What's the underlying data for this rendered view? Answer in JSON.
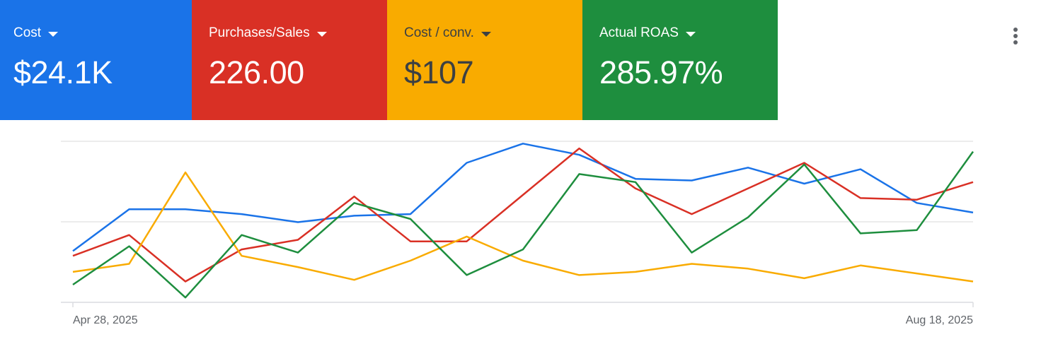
{
  "metrics": [
    {
      "label": "Cost",
      "value": "$24.1K",
      "bg": "#1a73e8",
      "fg": "#ffffff"
    },
    {
      "label": "Purchases/Sales",
      "value": "226.00",
      "bg": "#d93025",
      "fg": "#ffffff"
    },
    {
      "label": "Cost / conv.",
      "value": "$107",
      "bg": "#f9ab00",
      "fg": "#3c4043"
    },
    {
      "label": "Actual ROAS",
      "value": "285.97%",
      "bg": "#1e8e3e",
      "fg": "#ffffff"
    }
  ],
  "more_menu_icon": "more-vert-icon",
  "chart_data": {
    "type": "line",
    "x_start_label": "Apr 28, 2025",
    "x_end_label": "Aug 18, 2025",
    "x": [
      "Apr 28, 2025",
      "May 5, 2025",
      "May 12, 2025",
      "May 19, 2025",
      "May 26, 2025",
      "Jun 2, 2025",
      "Jun 9, 2025",
      "Jun 16, 2025",
      "Jun 23, 2025",
      "Jun 30, 2025",
      "Jul 7, 2025",
      "Jul 14, 2025",
      "Jul 21, 2025",
      "Jul 28, 2025",
      "Aug 4, 2025",
      "Aug 11, 2025",
      "Aug 18, 2025"
    ],
    "ylim": [
      0,
      1
    ],
    "grid": true,
    "legend": "none",
    "series": [
      {
        "color": "#1a73e8",
        "values": [
          0.32,
          0.58,
          0.58,
          0.55,
          0.5,
          0.54,
          0.55,
          0.87,
          0.99,
          0.92,
          0.77,
          0.76,
          0.84,
          0.74,
          0.83,
          0.62,
          0.56
        ]
      },
      {
        "color": "#d93025",
        "values": [
          0.29,
          0.42,
          0.13,
          0.33,
          0.39,
          0.66,
          0.38,
          0.38,
          0.67,
          0.96,
          0.71,
          0.55,
          0.71,
          0.87,
          0.65,
          0.64,
          0.75
        ]
      },
      {
        "color": "#f9ab00",
        "values": [
          0.19,
          0.24,
          0.81,
          0.29,
          0.22,
          0.14,
          0.26,
          0.41,
          0.26,
          0.17,
          0.19,
          0.24,
          0.21,
          0.15,
          0.23,
          0.18,
          0.13
        ]
      },
      {
        "color": "#1e8e3e",
        "values": [
          0.11,
          0.35,
          0.03,
          0.42,
          0.31,
          0.62,
          0.52,
          0.17,
          0.33,
          0.8,
          0.75,
          0.31,
          0.53,
          0.86,
          0.43,
          0.45,
          0.94
        ]
      }
    ]
  }
}
